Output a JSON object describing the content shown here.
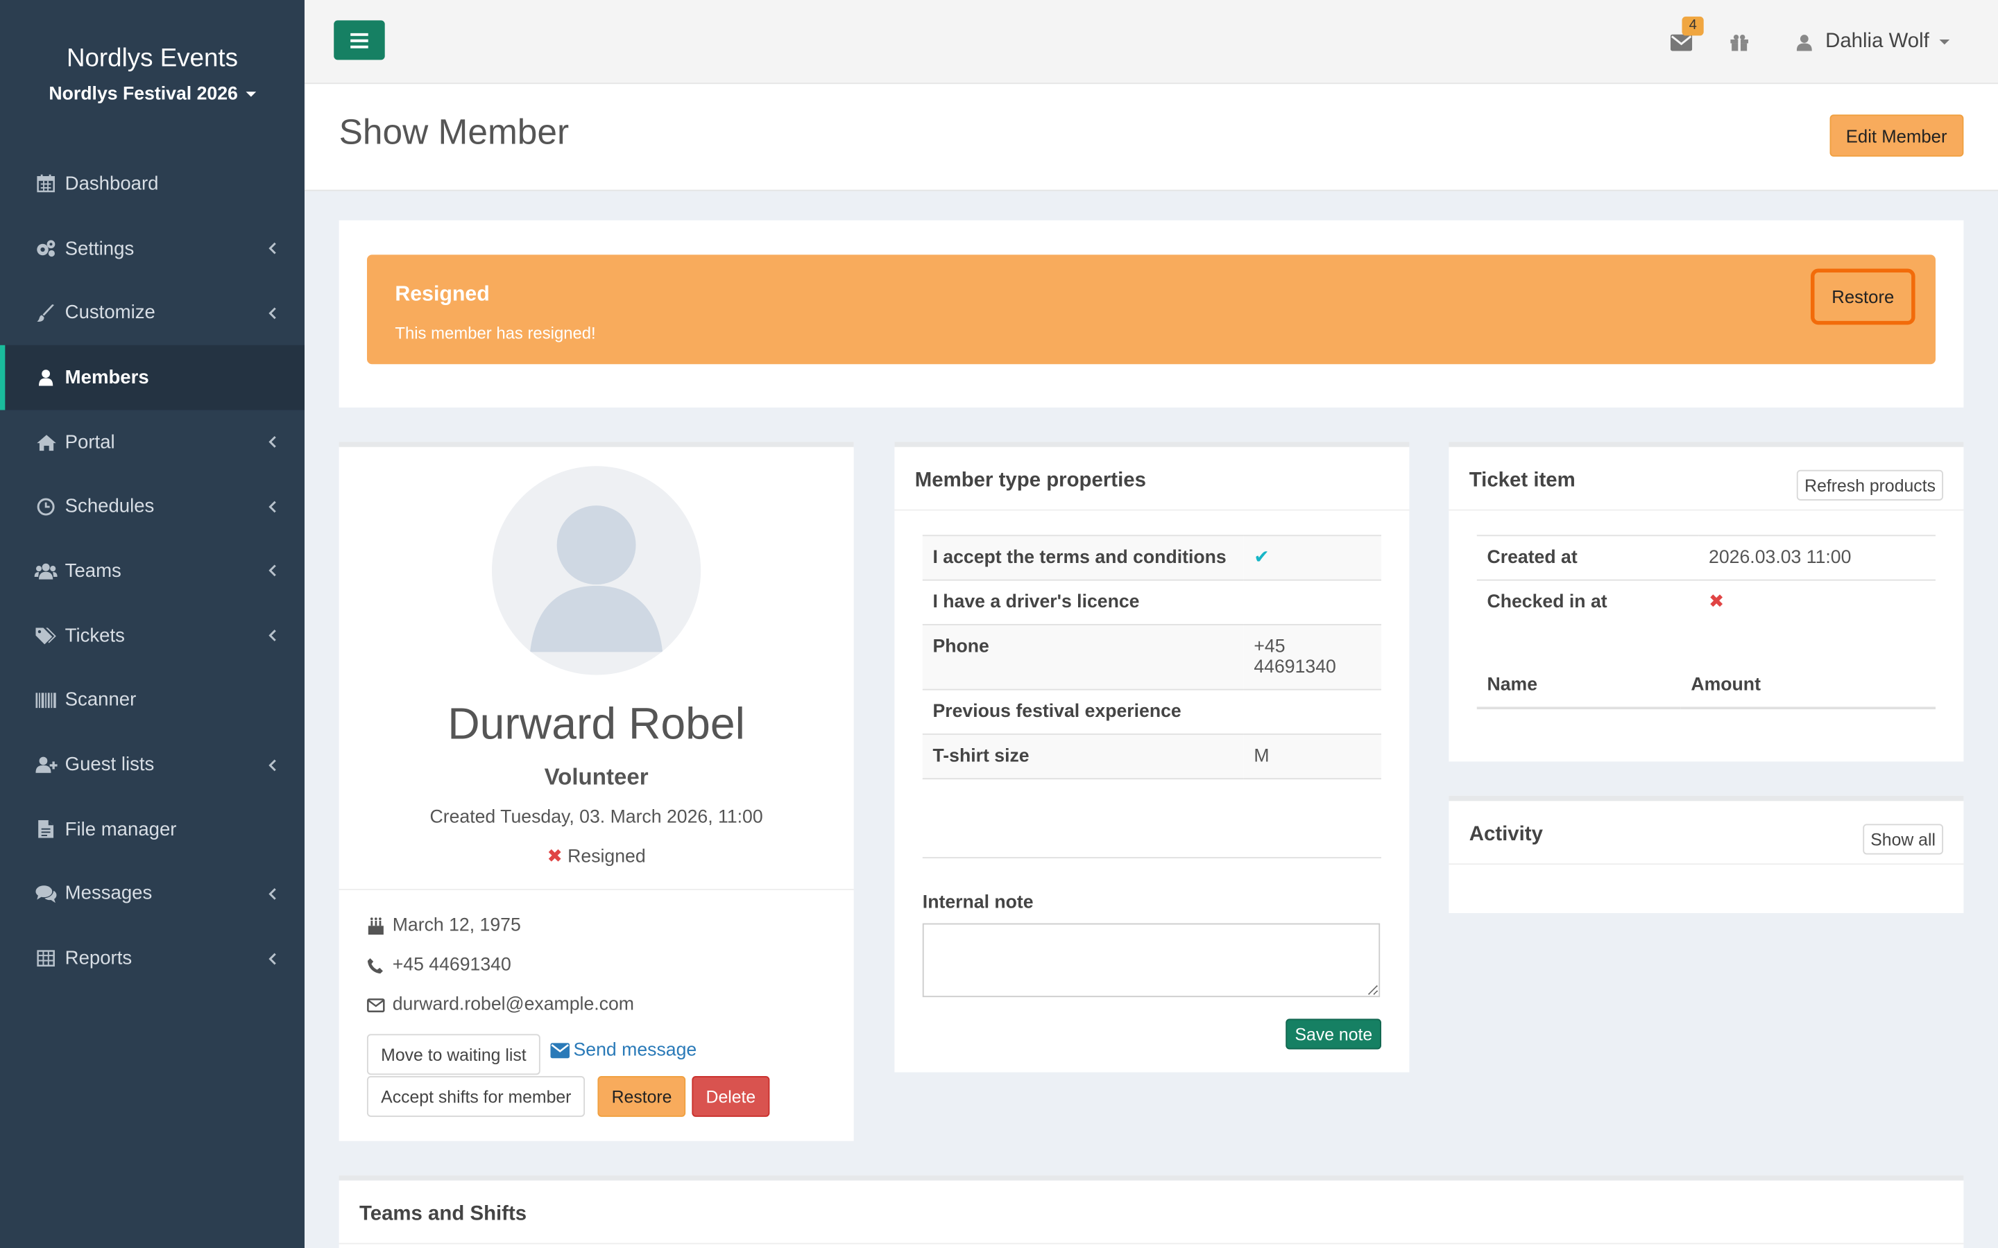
{
  "sidebar": {
    "brand": "Nordlys Events",
    "event_selector": "Nordlys Festival 2026",
    "items": [
      {
        "label": "Dashboard",
        "icon": "calendar-icon",
        "submenu": false
      },
      {
        "label": "Settings",
        "icon": "cogs-icon",
        "submenu": true
      },
      {
        "label": "Customize",
        "icon": "paintbrush-icon",
        "submenu": true
      },
      {
        "label": "Members",
        "icon": "user-icon",
        "submenu": false,
        "active": true
      },
      {
        "label": "Portal",
        "icon": "home-icon",
        "submenu": true
      },
      {
        "label": "Schedules",
        "icon": "clock-icon",
        "submenu": true
      },
      {
        "label": "Teams",
        "icon": "users-icon",
        "submenu": true
      },
      {
        "label": "Tickets",
        "icon": "tags-icon",
        "submenu": true
      },
      {
        "label": "Scanner",
        "icon": "barcode-icon",
        "submenu": false
      },
      {
        "label": "Guest lists",
        "icon": "user-plus-icon",
        "submenu": true
      },
      {
        "label": "File manager",
        "icon": "file-icon",
        "submenu": false
      },
      {
        "label": "Messages",
        "icon": "comments-icon",
        "submenu": true
      },
      {
        "label": "Reports",
        "icon": "table-icon",
        "submenu": true
      }
    ]
  },
  "topbar": {
    "messages_count": "4",
    "user_name": "Dahlia Wolf"
  },
  "header": {
    "title": "Show Member",
    "edit_button": "Edit Member"
  },
  "alert": {
    "title": "Resigned",
    "text": "This member has resigned!",
    "restore_button": "Restore"
  },
  "profile": {
    "name": "Durward Robel",
    "role": "Volunteer",
    "created": "Created Tuesday, 03. March 2026, 11:00",
    "status": "Resigned",
    "birthday": "March 12, 1975",
    "phone": "+45 44691340",
    "email": "durward.robel@example.com",
    "move_waiting_button": "Move to waiting list",
    "send_message_link": "Send message",
    "accept_shifts_button": "Accept shifts for member",
    "restore_button": "Restore",
    "delete_button": "Delete"
  },
  "member_props": {
    "title": "Member type properties",
    "rows": [
      {
        "key": "I accept the terms and conditions",
        "value": "",
        "check": true
      },
      {
        "key": "I have a driver's licence",
        "value": ""
      },
      {
        "key": "Phone",
        "value": "+45 44691340"
      },
      {
        "key": "Previous festival experience",
        "value": ""
      },
      {
        "key": "T-shirt size",
        "value": "M"
      }
    ],
    "note_label": "Internal note",
    "note_value": "",
    "save_button": "Save note"
  },
  "ticket": {
    "title": "Ticket item",
    "refresh_button": "Refresh products",
    "created_label": "Created at",
    "created_value": "2026.03.03 11:00",
    "checked_label": "Checked in at",
    "col_name": "Name",
    "col_amount": "Amount"
  },
  "activity": {
    "title": "Activity",
    "show_all_button": "Show all"
  },
  "teams": {
    "title": "Teams and Shifts"
  },
  "colors": {
    "sidebar": "#2c3e50",
    "accent_green": "#168063",
    "warning": "#f8ab5c",
    "danger": "#d9534f",
    "active_border": "#1abc9c"
  }
}
